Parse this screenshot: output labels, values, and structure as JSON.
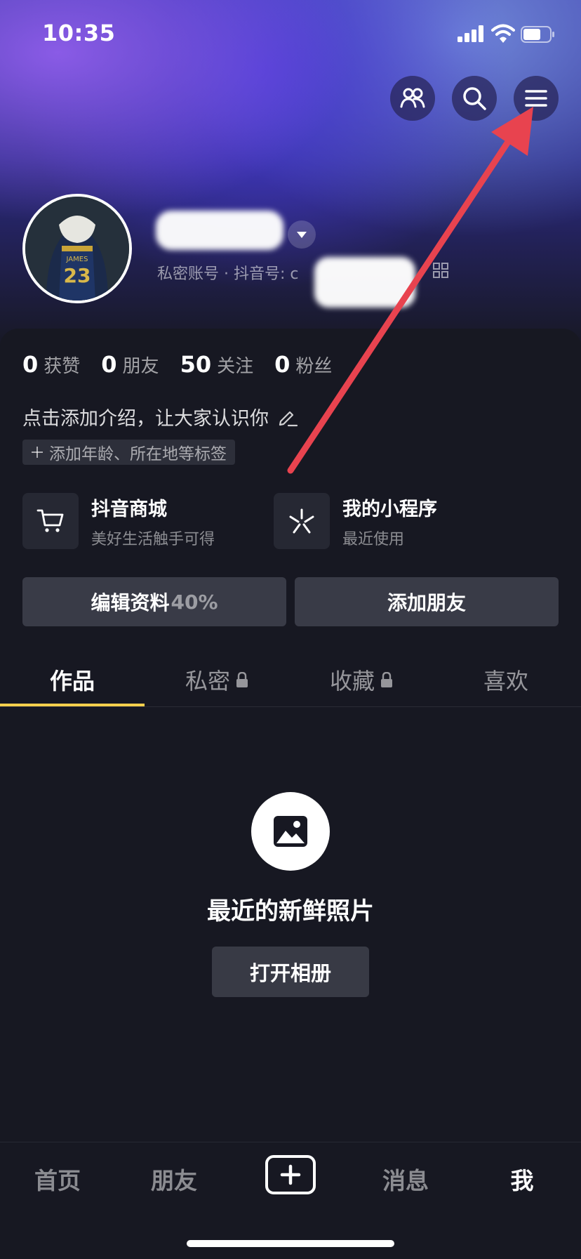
{
  "status_bar": {
    "time": "10:35"
  },
  "profile": {
    "account_line": "私密账号 · 抖音号: c"
  },
  "stats": [
    {
      "num": "0",
      "label": "获赞"
    },
    {
      "num": "0",
      "label": "朋友"
    },
    {
      "num": "50",
      "label": "关注"
    },
    {
      "num": "0",
      "label": "粉丝"
    }
  ],
  "intro": "点击添加介绍，让大家认识你",
  "tag_chip": "添加年龄、所在地等标签",
  "features": [
    {
      "title": "抖音商城",
      "sub": "美好生活触手可得",
      "icon": "cart-icon"
    },
    {
      "title": "我的小程序",
      "sub": "最近使用",
      "icon": "mini-program-icon"
    }
  ],
  "actions": {
    "edit_label": "编辑资料",
    "edit_percent": "40%",
    "add_friend": "添加朋友"
  },
  "tabs": [
    {
      "label": "作品",
      "locked": false,
      "active": true
    },
    {
      "label": "私密",
      "locked": true,
      "active": false
    },
    {
      "label": "收藏",
      "locked": true,
      "active": false
    },
    {
      "label": "喜欢",
      "locked": false,
      "active": false
    }
  ],
  "empty_state": {
    "title": "最近的新鲜照片",
    "button": "打开相册"
  },
  "bottom_nav": [
    {
      "label": "首页",
      "active": false
    },
    {
      "label": "朋友",
      "active": false
    },
    {
      "label": "消息",
      "active": false
    },
    {
      "label": "我",
      "active": true
    }
  ],
  "colors": {
    "background": "#171822",
    "tab_indicator": "#f6d04d",
    "annotation_arrow": "#e8434f"
  }
}
